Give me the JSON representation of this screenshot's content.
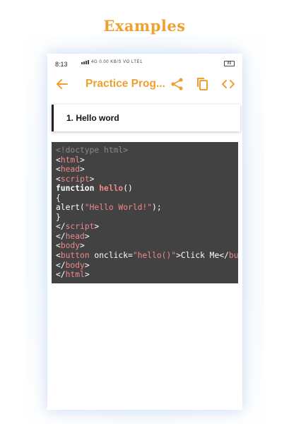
{
  "banner": {
    "title": "Examples"
  },
  "status_bar": {
    "time": "8:13",
    "network": "4G",
    "data_rate": "0.00 KB/S",
    "carrier": "VO LTE1",
    "battery": "89"
  },
  "toolbar": {
    "title": "Practice Prog..."
  },
  "snippet": {
    "title": "1. Hello word"
  },
  "code": {
    "lines": [
      [
        {
          "t": "<!doctype html>",
          "c": "comment"
        }
      ],
      [
        {
          "t": "<",
          "c": "plain"
        },
        {
          "t": "html",
          "c": "tag"
        },
        {
          "t": ">",
          "c": "plain"
        }
      ],
      [
        {
          "t": "<",
          "c": "plain"
        },
        {
          "t": "head",
          "c": "tag"
        },
        {
          "t": ">",
          "c": "plain"
        }
      ],
      [
        {
          "t": "<",
          "c": "plain"
        },
        {
          "t": "script",
          "c": "tag"
        },
        {
          "t": ">",
          "c": "plain"
        }
      ],
      [
        {
          "t": "function ",
          "c": "kw"
        },
        {
          "t": "hello",
          "c": "fn"
        },
        {
          "t": "()",
          "c": "plain"
        }
      ],
      [
        {
          "t": "{",
          "c": "plain"
        }
      ],
      [
        {
          "t": "alert(",
          "c": "plain"
        },
        {
          "t": "\"Hello World!\"",
          "c": "str"
        },
        {
          "t": ");",
          "c": "plain"
        }
      ],
      [
        {
          "t": "}",
          "c": "plain"
        }
      ],
      [
        {
          "t": "</",
          "c": "plain"
        },
        {
          "t": "script",
          "c": "tag"
        },
        {
          "t": ">",
          "c": "plain"
        }
      ],
      [
        {
          "t": "</",
          "c": "plain"
        },
        {
          "t": "head",
          "c": "tag"
        },
        {
          "t": ">",
          "c": "plain"
        }
      ],
      [
        {
          "t": "<",
          "c": "plain"
        },
        {
          "t": "body",
          "c": "tag"
        },
        {
          "t": ">",
          "c": "plain"
        }
      ],
      [
        {
          "t": "<",
          "c": "plain"
        },
        {
          "t": "button ",
          "c": "tag"
        },
        {
          "t": "onclick=",
          "c": "plain"
        },
        {
          "t": "\"hello()\"",
          "c": "str"
        },
        {
          "t": ">Click Me</",
          "c": "plain"
        },
        {
          "t": "button",
          "c": "tag"
        },
        {
          "t": ">",
          "c": "plain"
        }
      ],
      [
        {
          "t": "</",
          "c": "plain"
        },
        {
          "t": "body",
          "c": "tag"
        },
        {
          "t": ">",
          "c": "plain"
        }
      ],
      [
        {
          "t": "</",
          "c": "plain"
        },
        {
          "t": "html",
          "c": "tag"
        },
        {
          "t": ">",
          "c": "plain"
        }
      ]
    ]
  }
}
